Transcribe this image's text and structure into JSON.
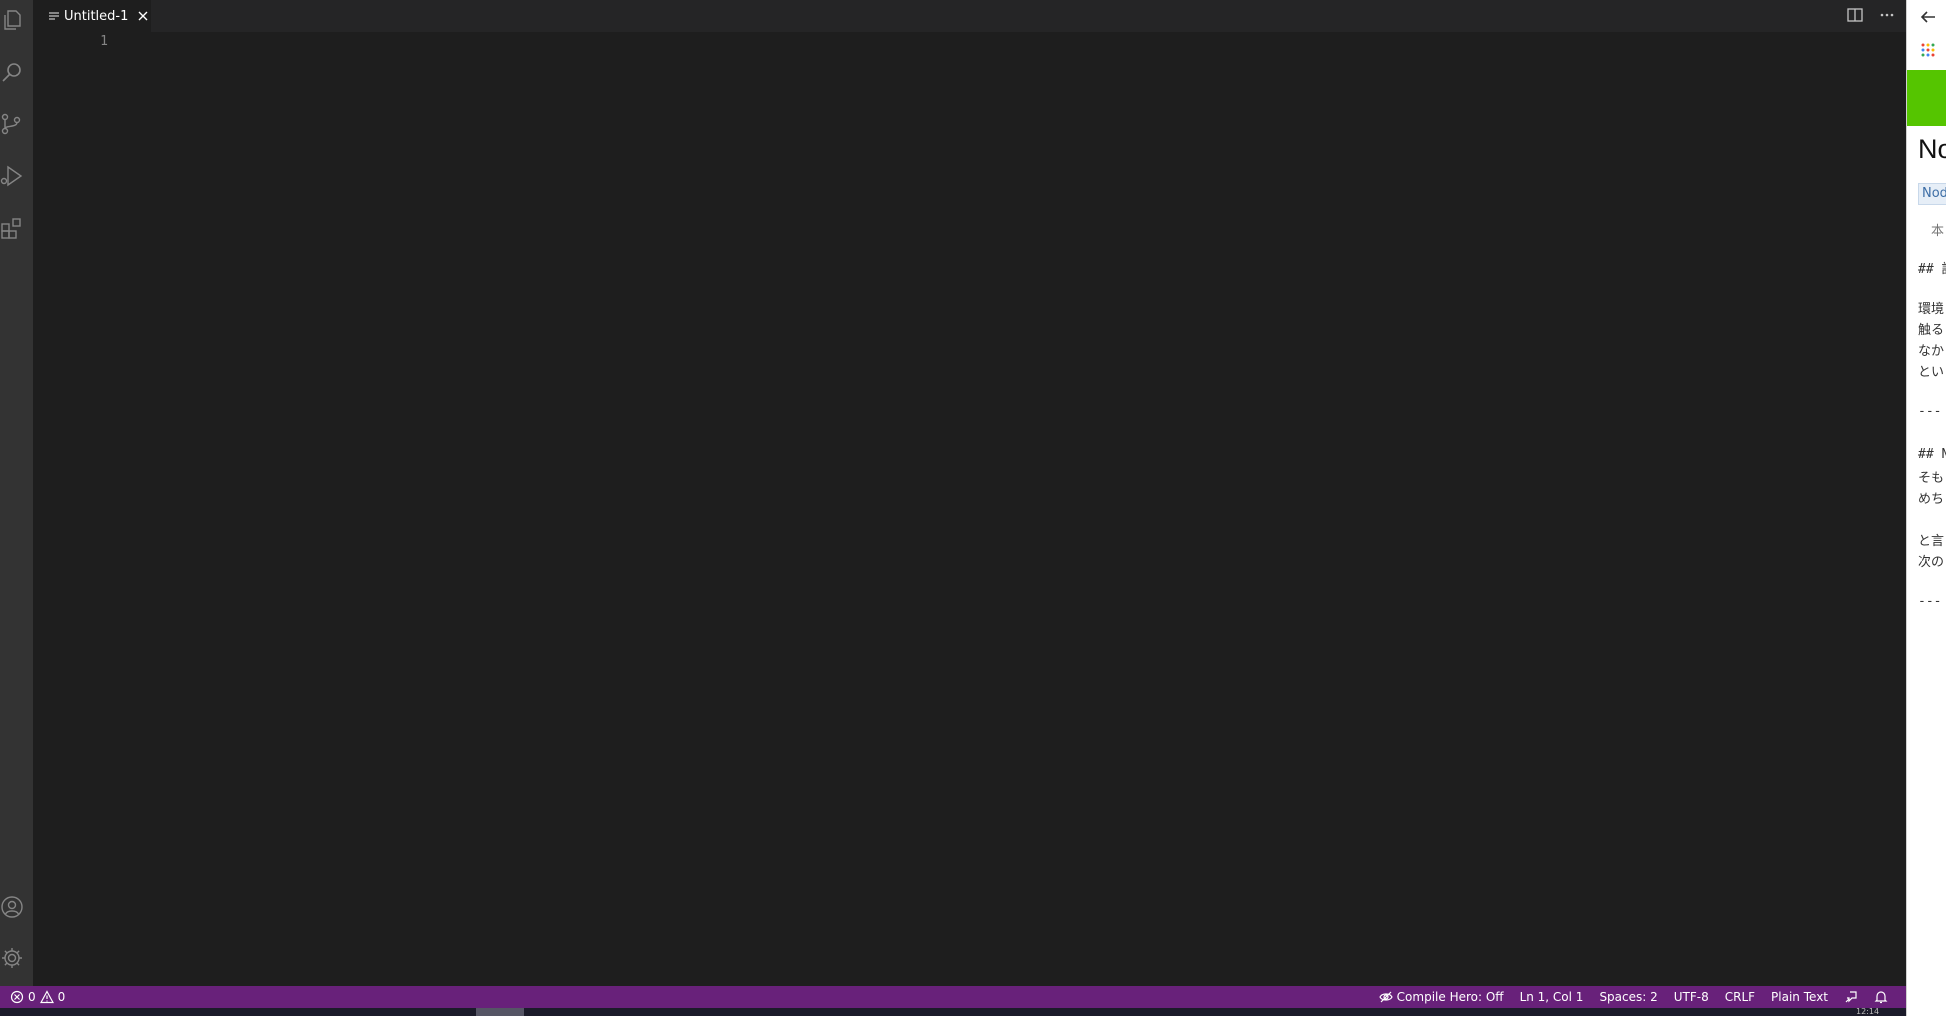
{
  "activity_bar": {
    "top_icons": [
      "explorer-icon",
      "search-icon",
      "source-control-icon",
      "run-debug-icon",
      "extensions-icon"
    ],
    "bottom_icons": [
      "accounts-icon",
      "manage-gear-icon"
    ]
  },
  "editor": {
    "tabs": [
      {
        "label": "Untitled-1",
        "icon": "plain-text-file-icon"
      }
    ],
    "line_numbers": [
      "1"
    ]
  },
  "status_bar": {
    "errors": "0",
    "warnings": "0",
    "compile_hero": "Compile Hero: Off",
    "cursor": "Ln 1, Col 1",
    "spaces": "Spaces: 2",
    "encoding": "UTF-8",
    "eol": "CRLF",
    "language": "Plain Text",
    "background_color": "#68217a"
  },
  "browser": {
    "banner_color": "#55c500",
    "title": "No",
    "tag": "Nod",
    "lines": [
      "本",
      "## 記",
      "環境",
      "触る",
      "なか",
      "とい",
      "---",
      "## N",
      "そも",
      "めち",
      "と言",
      "次の",
      "---"
    ]
  },
  "taskbar": {
    "clock": "12:14"
  }
}
